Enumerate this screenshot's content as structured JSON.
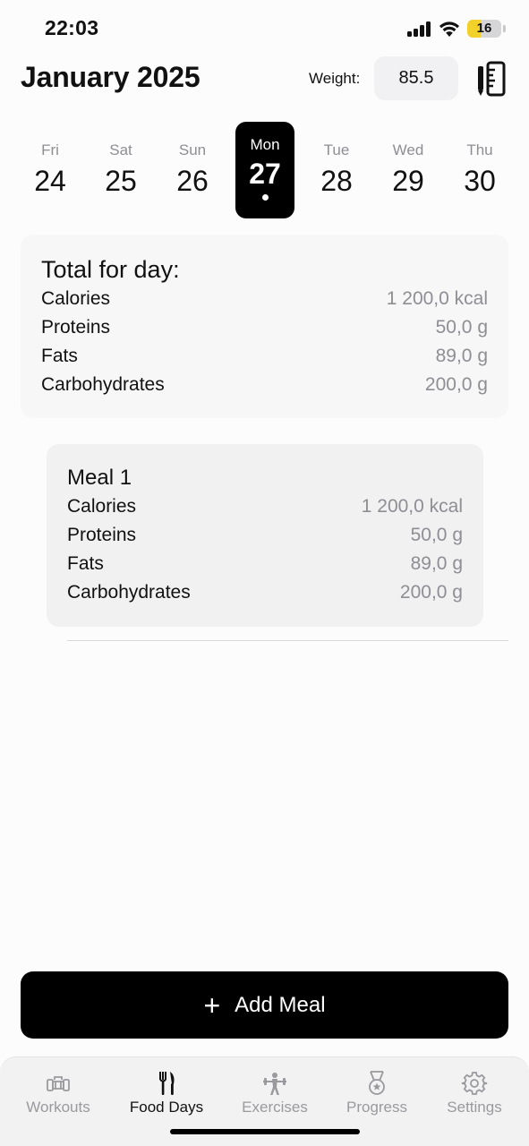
{
  "status_bar": {
    "time": "22:03",
    "battery": "16"
  },
  "header": {
    "title": "January 2025",
    "weight_label": "Weight:",
    "weight_value": "85.5"
  },
  "days": [
    {
      "name": "Fri",
      "num": "24"
    },
    {
      "name": "Sat",
      "num": "25"
    },
    {
      "name": "Sun",
      "num": "26"
    },
    {
      "name": "Mon",
      "num": "27",
      "selected": true
    },
    {
      "name": "Tue",
      "num": "28"
    },
    {
      "name": "Wed",
      "num": "29"
    },
    {
      "name": "Thu",
      "num": "30"
    }
  ],
  "total": {
    "title": "Total for day:",
    "rows": [
      {
        "label": "Calories",
        "value": "1 200,0 kcal"
      },
      {
        "label": "Proteins",
        "value": "50,0 g"
      },
      {
        "label": "Fats",
        "value": "89,0 g"
      },
      {
        "label": "Carbohydrates",
        "value": "200,0 g"
      }
    ]
  },
  "meal": {
    "title": "Meal 1",
    "rows": [
      {
        "label": "Calories",
        "value": "1 200,0 kcal"
      },
      {
        "label": "Proteins",
        "value": "50,0 g"
      },
      {
        "label": "Fats",
        "value": "89,0 g"
      },
      {
        "label": "Carbohydrates",
        "value": "200,0 g"
      }
    ]
  },
  "add_meal_label": "Add Meal",
  "tabs": [
    {
      "label": "Workouts",
      "icon": "dumbbell-icon"
    },
    {
      "label": "Food Days",
      "icon": "fork-knife-icon",
      "active": true
    },
    {
      "label": "Exercises",
      "icon": "weightlifter-icon"
    },
    {
      "label": "Progress",
      "icon": "medal-icon"
    },
    {
      "label": "Settings",
      "icon": "gear-icon"
    }
  ],
  "colors": {
    "accent": "#000000",
    "muted": "#8e8e93",
    "card": "#f7f7f8",
    "battery": "#f2d22a"
  }
}
